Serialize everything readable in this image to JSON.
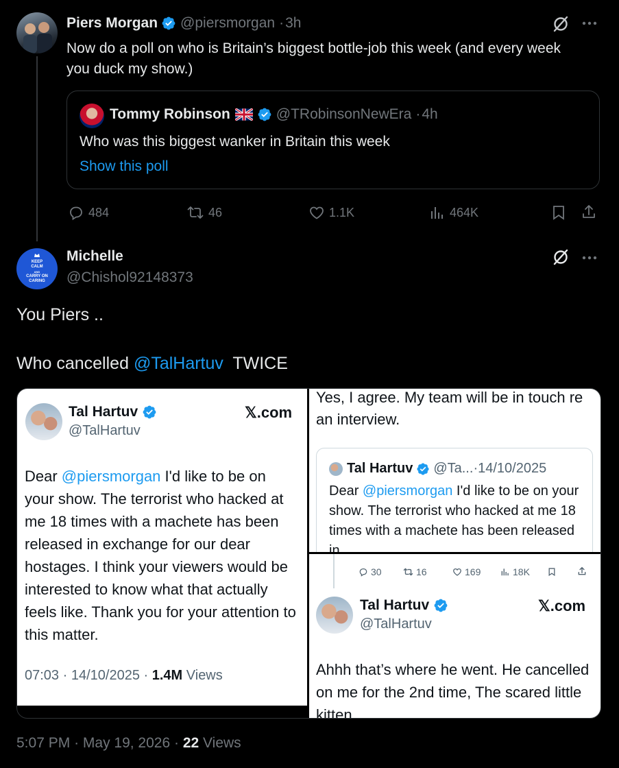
{
  "tweet1": {
    "author_name": "Piers Morgan",
    "handle": "@piersmorgan",
    "time": "3h",
    "text": "Now do a poll on who is Britain’s biggest bottle-job this week (and every week you duck my show.)",
    "quote": {
      "author_name": "Tommy Robinson",
      "flag": "🇬🇧",
      "handle": "@TRobinsonNewEra",
      "time": "4h",
      "text": "Who was this biggest wanker in Britain this week",
      "show_poll": "Show this poll"
    },
    "actions": {
      "replies": "484",
      "reposts": "46",
      "likes": "1.1K",
      "views": "464K"
    }
  },
  "tweet2": {
    "author_name": "Michelle",
    "handle": "@Chishol92148373",
    "avatar_text": [
      "KEEP",
      "CALM",
      "AND",
      "CARRY ON",
      "CARING"
    ],
    "line1": "You Piers ..",
    "line2_prefix": "Who cancelled ",
    "line2_mention": "@TalHartuv",
    "line2_suffix": "  TWICE",
    "footer": {
      "time": "5:07 PM",
      "date": "May 19, 2026",
      "views_count": "22",
      "views_label": "Views"
    }
  },
  "media": {
    "img1": {
      "name": "Tal Hartuv",
      "handle": "@TalHartuv",
      "brand": "𝕏.com",
      "text_prefix": "Dear ",
      "mention": "@piersmorgan",
      "text_rest": " I'd like to be on your show. The terrorist who hacked at me 18 times with a machete has been released in exchange for our dear hostages. I think your viewers would be interested to know what that actually feels like. Thank you for your attention to this matter.",
      "time": "07:03",
      "date": "14/10/2025",
      "views_count": "1.4M",
      "views_label": "Views"
    },
    "img2": {
      "text": "Yes, I agree. My team will be in touch re an interview.",
      "quote_name": "Tal Hartuv",
      "quote_handle": "@Ta...",
      "quote_date": "14/10/2025",
      "quote_prefix": "Dear ",
      "quote_mention": "@piersmorgan",
      "quote_rest": " I'd like to be on your show. The terrorist who hacked at me 18 times with a machete has been released in"
    },
    "img3": {
      "replies": "30",
      "reposts": "16",
      "likes": "169",
      "views": "18K",
      "name": "Tal Hartuv",
      "handle": "@TalHartuv",
      "brand": "𝕏.com",
      "text": "Ahhh that’s where he went.  He cancelled on me for the 2nd time, The scared little kitten"
    }
  },
  "colors": {
    "background": "#000000",
    "text": "#e7e9ea",
    "muted": "#71767b",
    "accent": "#1d9bf0"
  },
  "icons": [
    "grok-icon",
    "more-icon",
    "reply-icon",
    "repost-icon",
    "like-icon",
    "views-icon",
    "bookmark-icon",
    "share-icon",
    "verified-icon"
  ]
}
